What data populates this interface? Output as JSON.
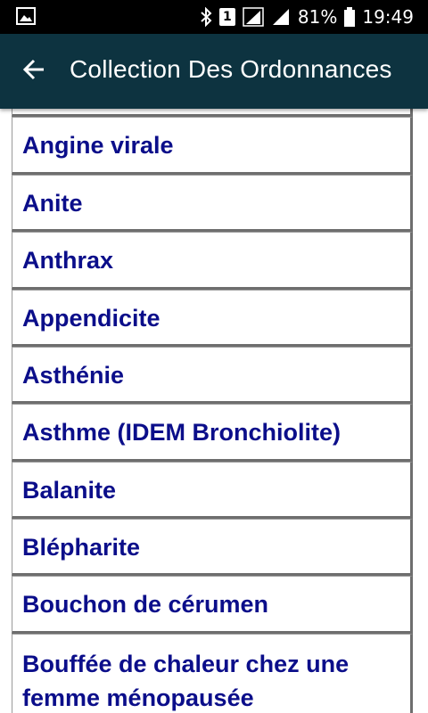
{
  "status_bar": {
    "battery": "81%",
    "time": "19:49",
    "sim_slot": "1",
    "icons": [
      "image-notification-icon",
      "bluetooth-icon",
      "sim-1-icon",
      "signal-1-icon",
      "signal-2-icon",
      "battery-icon"
    ]
  },
  "app_bar": {
    "back_icon": "arrow-left-icon",
    "title": "Collection Des Ordonnances"
  },
  "list": {
    "items": [
      {
        "label": ""
      },
      {
        "label": "Angine virale"
      },
      {
        "label": "Anite"
      },
      {
        "label": "Anthrax"
      },
      {
        "label": "Appendicite"
      },
      {
        "label": "Asthénie"
      },
      {
        "label": "Asthme (IDEM Bronchiolite)"
      },
      {
        "label": "Balanite"
      },
      {
        "label": "Blépharite"
      },
      {
        "label": "Bouchon de cérumen"
      },
      {
        "label": "Bouffée de chaleur chez une femme ménopausée"
      }
    ]
  },
  "colors": {
    "status_bar": "#000000",
    "app_bar": "#0d3340",
    "item_text": "#0b0e8a",
    "background": "#ffffff"
  }
}
